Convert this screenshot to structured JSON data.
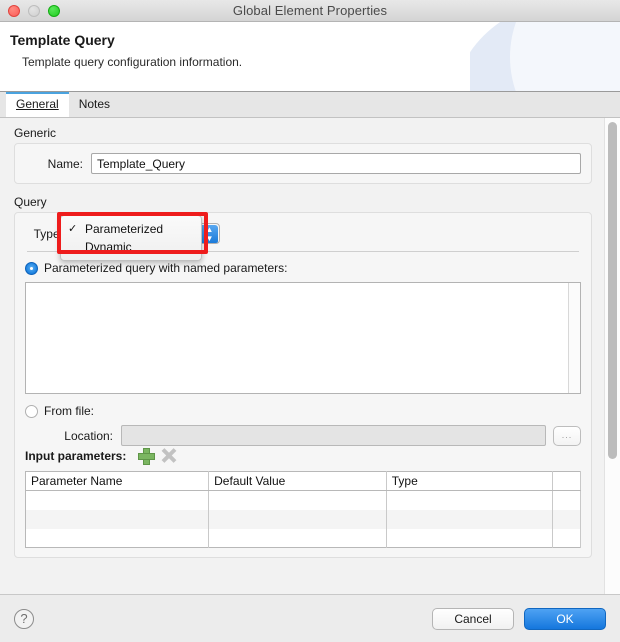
{
  "window": {
    "title": "Global Element Properties",
    "traffic_lights": [
      "close-button",
      "minimize-button",
      "maximize-button"
    ]
  },
  "header": {
    "title": "Template Query",
    "subtitle": "Template query configuration information."
  },
  "tabs": [
    {
      "label": "General",
      "active": true
    },
    {
      "label": "Notes",
      "active": false
    }
  ],
  "generic": {
    "group_label": "Generic",
    "name_label": "Name:",
    "name_value": "Template_Query",
    "name_placeholder": ""
  },
  "query": {
    "group_label": "Query",
    "type_label": "Type:",
    "type_value": "Parameterized",
    "dropdown_open": true,
    "dropdown_items": [
      {
        "label": "Parameterized",
        "checked": true
      },
      {
        "label": "Dynamic",
        "checked": false
      }
    ],
    "radio_parameterized": "Parameterized query with named parameters:",
    "radio_from_file": "From file:",
    "query_text": "",
    "location_label": "Location:",
    "location_value": "",
    "browse_label": "..."
  },
  "params": {
    "label": "Input parameters:",
    "add_icon": "plus-icon",
    "delete_icon": "delete-x-icon",
    "columns": [
      "Parameter Name",
      "Default Value",
      "Type",
      ""
    ],
    "rows": [
      [
        "",
        "",
        "",
        ""
      ],
      [
        "",
        "",
        "",
        ""
      ],
      [
        "",
        "",
        "",
        ""
      ]
    ]
  },
  "footer": {
    "help_label": "?",
    "cancel_label": "Cancel",
    "ok_label": "OK"
  },
  "colors": {
    "accent": "#1577dd",
    "annotation": "#ee1c1c",
    "tab_active": "#4aa3df",
    "add_icon": "#7bb661"
  }
}
